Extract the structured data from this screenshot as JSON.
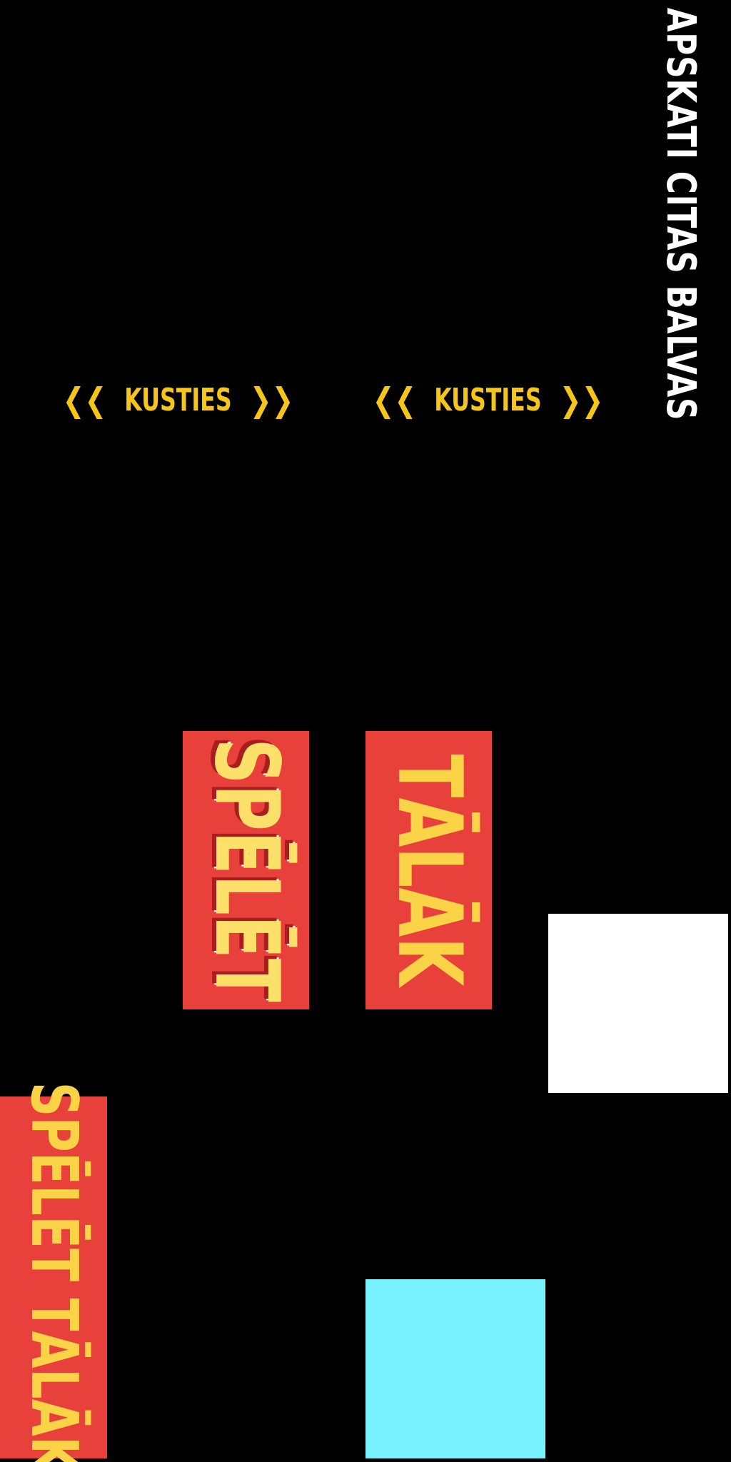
{
  "labels": {
    "more_prizes": "APSKATI CITAS BALVAS",
    "kusties": "KUSTIES",
    "arrow_left": "❮❮",
    "arrow_right": "❯❯",
    "play": "SPĒLĒT",
    "next": "TĀLĀK",
    "play_further": "SPĒLĒT TĀLĀK"
  },
  "colors": {
    "background": "#000000",
    "button_red": "#e8403a",
    "text_yellow": "#fbd346",
    "kusties_yellow": "#f5c518",
    "panel_white": "#ffffff",
    "panel_cyan": "#78f2ff"
  }
}
